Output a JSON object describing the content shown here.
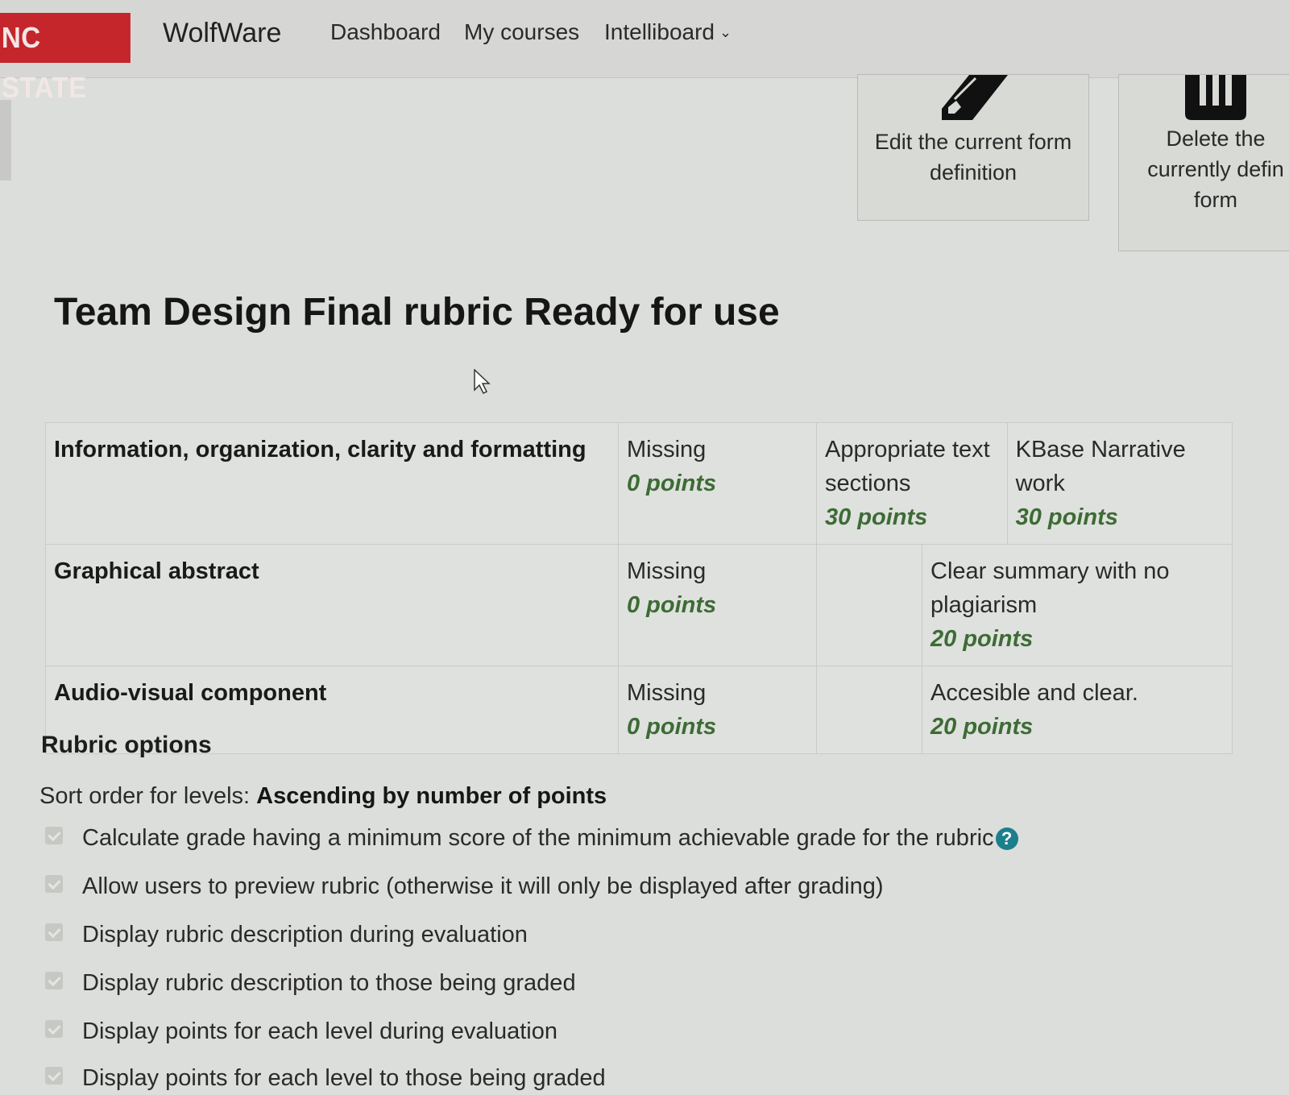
{
  "navbar": {
    "logo": "NC STATE",
    "brand": "WolfWare",
    "links": [
      "Dashboard",
      "My courses",
      "Intelliboard"
    ],
    "dropdown_icon": "chevron-down-icon"
  },
  "actions": {
    "edit": {
      "label": "Edit the current form definition",
      "icon": "pencil-icon"
    },
    "delete": {
      "label": "Delete the currently defin form",
      "icon": "trash-icon"
    }
  },
  "page_title": "Team Design Final rubric Ready for use",
  "rubric": {
    "criteria": [
      {
        "name": "Information, organization, clarity and formatting",
        "levels": [
          {
            "definition": "Missing",
            "score": "0 points"
          },
          {
            "definition": "Appropriate text sections",
            "score": "30 points"
          },
          {
            "definition": "KBase Narrative work",
            "score": "30 points"
          }
        ]
      },
      {
        "name": "Graphical abstract",
        "levels": [
          {
            "definition": "Missing",
            "score": "0 points"
          },
          {
            "definition": "Clear summary with no plagiarism",
            "score": "20 points"
          }
        ]
      },
      {
        "name": "Audio-visual component",
        "levels": [
          {
            "definition": "Missing",
            "score": "0 points"
          },
          {
            "definition": "Accesible and clear.",
            "score": "20 points"
          }
        ]
      }
    ]
  },
  "options": {
    "heading": "Rubric options",
    "sort_label": "Sort order for levels:",
    "sort_value": "Ascending by number of points",
    "items": [
      {
        "label": "Calculate grade having a minimum score of the minimum achievable grade for the rubric",
        "checked": true,
        "help": true
      },
      {
        "label": "Allow users to preview rubric (otherwise it will only be displayed after grading)",
        "checked": true
      },
      {
        "label": "Display rubric description during evaluation",
        "checked": true
      },
      {
        "label": "Display rubric description to those being graded",
        "checked": true
      },
      {
        "label": "Display points for each level during evaluation",
        "checked": true
      },
      {
        "label": "Display points for each level to those being graded",
        "checked": true
      }
    ],
    "help_glyph": "?"
  },
  "colors": {
    "brand_red": "#c4262c",
    "score_green": "#3d6b35",
    "help_teal": "#1b7f8c"
  }
}
